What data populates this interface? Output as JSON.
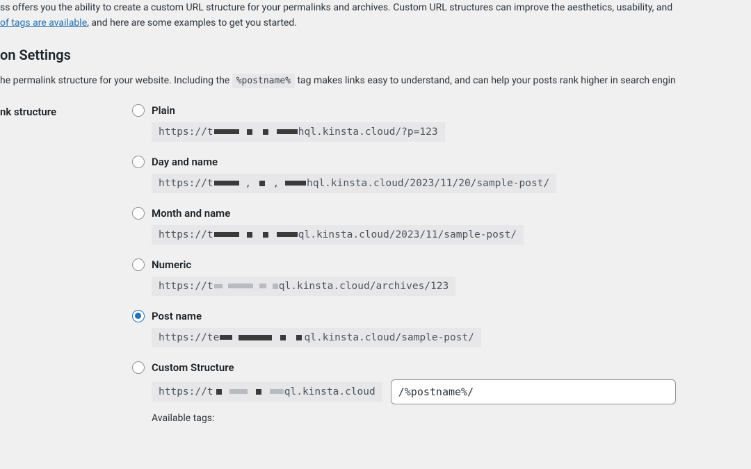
{
  "intro": {
    "text_before_link": "ss offers you the ability to create a custom URL structure for your permalinks and archives. Custom URL structures can improve the aesthetics, usability, and ",
    "link_text": "of tags are available",
    "text_after_link": ", and here are some examples to get you started."
  },
  "heading": "on Settings",
  "desc": {
    "before_tag": "he permalink structure for your website. Including the ",
    "tag": "%postname%",
    "after_tag": " tag makes links easy to understand, and can help your posts rank higher in search engin"
  },
  "row_label": "nk structure",
  "options": {
    "plain": {
      "label": "Plain",
      "url_prefix": "https://t",
      "url_suffix": "hql.kinsta.cloud/?p=123"
    },
    "day_name": {
      "label": "Day and name",
      "url_prefix": "https://t",
      "url_suffix": "hql.kinsta.cloud/2023/11/20/sample-post/"
    },
    "month_name": {
      "label": "Month and name",
      "url_prefix": "https://t",
      "url_suffix": "ql.kinsta.cloud/2023/11/sample-post/"
    },
    "numeric": {
      "label": "Numeric",
      "url_prefix": "https://t",
      "url_suffix": "ql.kinsta.cloud/archives/123"
    },
    "post_name": {
      "label": "Post name",
      "url_prefix": "https://te",
      "url_suffix": "ql.kinsta.cloud/sample-post/"
    },
    "custom": {
      "label": "Custom Structure",
      "url_prefix": "https://t",
      "url_suffix": "ql.kinsta.cloud",
      "input_value": "/%postname%/",
      "available_tags": "Available tags:"
    }
  },
  "selected": "post_name"
}
